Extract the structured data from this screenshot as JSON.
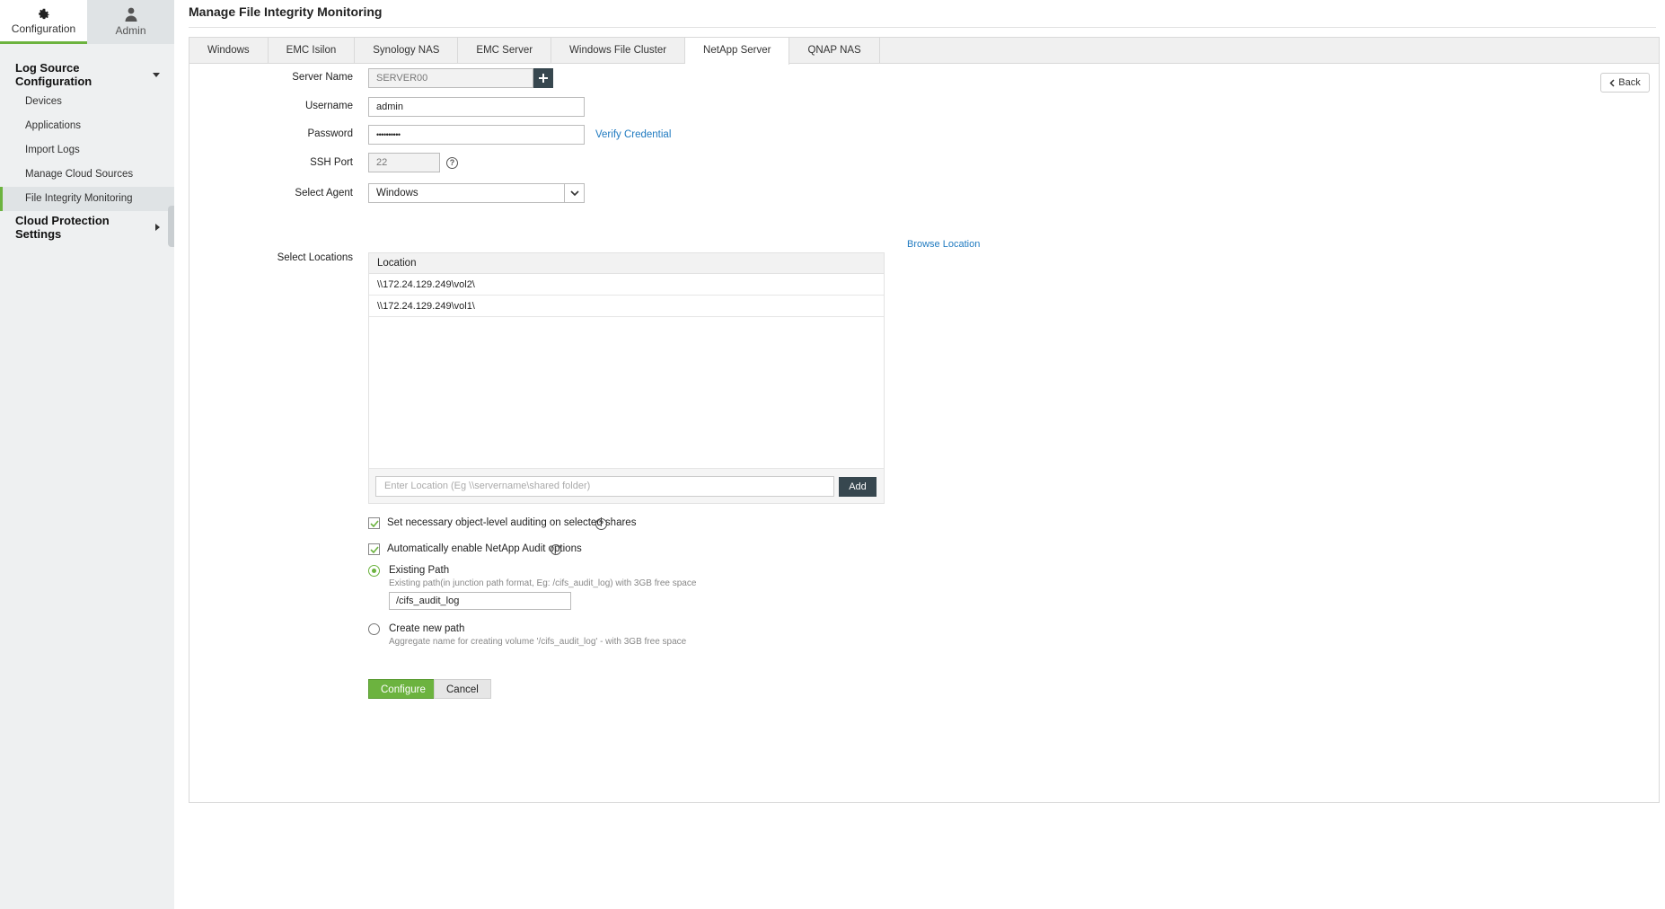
{
  "topnav": [
    {
      "label": "Configuration",
      "icon": "gear-icon",
      "active": true
    },
    {
      "label": "Admin",
      "icon": "user-icon",
      "active": false
    }
  ],
  "sidebar": {
    "section_log_source": "Log Source Configuration",
    "items": [
      {
        "label": "Devices"
      },
      {
        "label": "Applications"
      },
      {
        "label": "Import Logs"
      },
      {
        "label": "Manage Cloud Sources"
      },
      {
        "label": "File Integrity Monitoring"
      }
    ],
    "selected": "File Integrity Monitoring",
    "section_cloud": "Cloud Protection Settings"
  },
  "page_title": "Manage File Integrity Monitoring",
  "tabs": [
    {
      "label": "Windows"
    },
    {
      "label": "EMC Isilon"
    },
    {
      "label": "Synology NAS"
    },
    {
      "label": "EMC Server"
    },
    {
      "label": "Windows File Cluster"
    },
    {
      "label": "NetApp Server"
    },
    {
      "label": "QNAP NAS"
    }
  ],
  "active_tab": "NetApp Server",
  "back_label": "Back",
  "form": {
    "server_name_label": "Server Name",
    "server_name_value": "SERVER00",
    "username_label": "Username",
    "username_value": "admin",
    "password_label": "Password",
    "password_value": "••••••••••",
    "verify_credential": "Verify Credential",
    "ssh_port_label": "SSH Port",
    "ssh_port_value": "22",
    "help_glyph": "?",
    "select_agent_label": "Select Agent",
    "select_agent_value": "Windows",
    "browse_location": "Browse Location",
    "select_locations_label": "Select Locations",
    "location_header": "Location",
    "locations": [
      "\\\\172.24.129.249\\vol2\\",
      "\\\\172.24.129.249\\vol1\\"
    ],
    "location_placeholder": "Enter Location (Eg \\\\servername\\shared folder)",
    "add_label": "Add"
  },
  "options": {
    "object_level_auditing": {
      "label": "Set necessary object-level auditing on selected shares",
      "checked": true
    },
    "auto_enable_audit": {
      "label": "Automatically enable NetApp Audit options",
      "checked": true
    },
    "info_glyph": "i",
    "existing_path": {
      "label": "Existing Path",
      "hint": "Existing path(in junction path format, Eg: /cifs_audit_log) with 3GB free space",
      "value": "/cifs_audit_log",
      "selected": true
    },
    "create_new_path": {
      "label": "Create new path",
      "hint": "Aggregate name for creating volume '/cifs_audit_log' - with 3GB free space",
      "selected": false
    }
  },
  "actions": {
    "configure": "Configure",
    "cancel": "Cancel"
  },
  "colors": {
    "accent": "#6cb33f",
    "dark_button": "#37474f",
    "link": "#1f7ac0"
  }
}
